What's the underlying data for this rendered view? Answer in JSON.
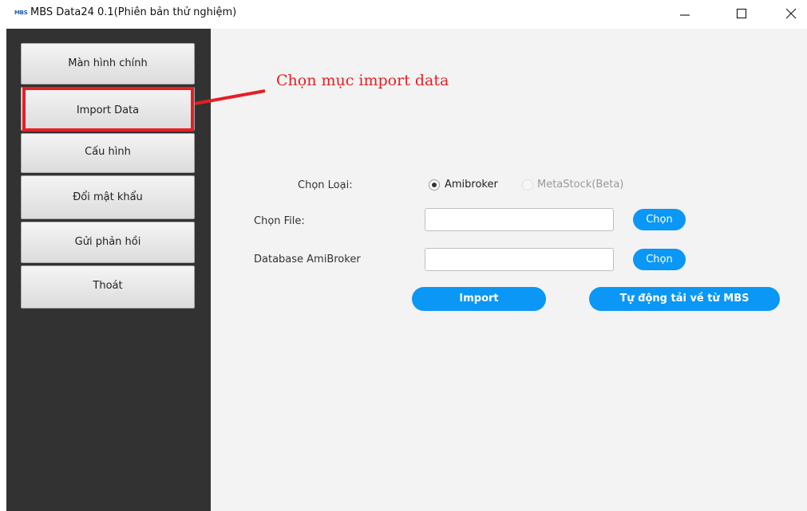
{
  "window": {
    "logo_text": "MBS",
    "title": "MBS Data24 0.1(Phiên bản thử nghiệm)"
  },
  "sidebar": {
    "items": [
      {
        "label": "Màn hình chính"
      },
      {
        "label": "Import Data"
      },
      {
        "label": "Cấu hình"
      },
      {
        "label": "Đổi mật khẩu"
      },
      {
        "label": "Gửi phản hồi"
      },
      {
        "label": "Thoát"
      }
    ]
  },
  "annotation": {
    "callout_text": "Chọn mục import data",
    "color": "#e51f24"
  },
  "form": {
    "type_label": "Chọn Loại:",
    "type_options": [
      {
        "label": "Amibroker",
        "selected": true
      },
      {
        "label": "MetaStock(Beta)",
        "selected": false
      }
    ],
    "file_label": "Chọn File:",
    "file_value": "",
    "file_button": "Chọn",
    "db_label": "Database AmiBroker",
    "db_value": "",
    "db_button": "Chọn",
    "import_button": "Import",
    "auto_download_button": "Tự động tải về từ MBS"
  },
  "colors": {
    "sidebar_bg": "#323232",
    "content_bg": "#f3f3f3",
    "accent_blue": "#0a97f5"
  }
}
